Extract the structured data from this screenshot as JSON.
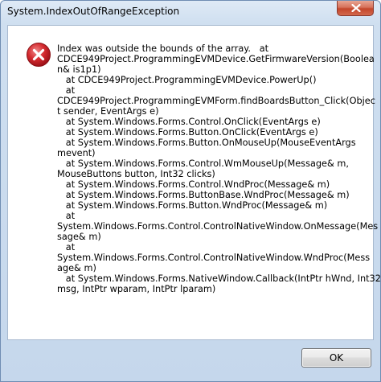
{
  "window": {
    "title": "System.IndexOutOfRangeException"
  },
  "dialog": {
    "icon": "error-icon",
    "message_lines": [
      "Index was outside the bounds of the array.   at",
      "CDCE949Project.ProgrammingEVMDevice.GetFirmwareVersion(Boolea",
      "n& is1p1)",
      "   at CDCE949Project.ProgrammingEVMDevice.PowerUp()",
      "   at",
      "CDCE949Project.ProgrammingEVMForm.findBoardsButton_Click(Objec",
      "t sender, EventArgs e)",
      "   at System.Windows.Forms.Control.OnClick(EventArgs e)",
      "   at System.Windows.Forms.Button.OnClick(EventArgs e)",
      "   at System.Windows.Forms.Button.OnMouseUp(MouseEventArgs",
      "mevent)",
      "   at System.Windows.Forms.Control.WmMouseUp(Message& m,",
      "MouseButtons button, Int32 clicks)",
      "   at System.Windows.Forms.Control.WndProc(Message& m)",
      "   at System.Windows.Forms.ButtonBase.WndProc(Message& m)",
      "   at System.Windows.Forms.Button.WndProc(Message& m)",
      "   at",
      "System.Windows.Forms.Control.ControlNativeWindow.OnMessage(Mes",
      "sage& m)",
      "   at",
      "System.Windows.Forms.Control.ControlNativeWindow.WndProc(Mess",
      "age& m)",
      "   at System.Windows.Forms.NativeWindow.Callback(IntPtr hWnd, Int32",
      "msg, IntPtr wparam, IntPtr lparam)"
    ],
    "ok_label": "OK"
  },
  "colors": {
    "close_button": "#c3462c",
    "error_icon": "#c8202a"
  }
}
